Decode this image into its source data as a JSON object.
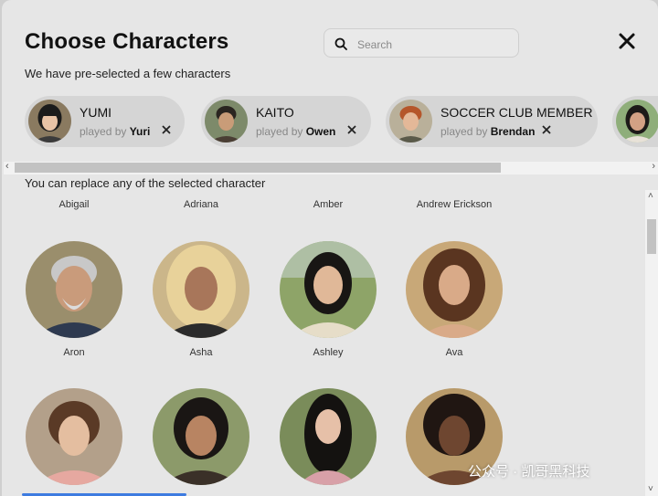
{
  "header": {
    "title": "Choose Characters",
    "subtitle": "We have pre-selected a few characters",
    "search_placeholder": "Search"
  },
  "selected": [
    {
      "name": "YUMI",
      "played_by_label": "played by",
      "actor": "Yuri"
    },
    {
      "name": "KAITO",
      "played_by_label": "played by",
      "actor": "Owen"
    },
    {
      "name": "SOCCER CLUB MEMBER",
      "played_by_label": "played by",
      "actor": "Brendan"
    }
  ],
  "replace_text": "You can replace any of the selected character",
  "list": {
    "name_only": [
      "Abigail",
      "Adriana",
      "Amber",
      "Andrew Erickson"
    ],
    "row1": [
      "Aron",
      "Asha",
      "Ashley",
      "Ava"
    ],
    "row2": [
      "",
      "",
      "",
      ""
    ]
  },
  "watermark": "公众号 · 凯哥黑科技",
  "colors": {
    "modal_bg": "#e6e6e6",
    "chip_bg": "#d5d5d5",
    "accent": "#3d7be0"
  },
  "icons": [
    "search-icon",
    "close-icon",
    "remove-icon",
    "chevron-left-icon",
    "chevron-right-icon",
    "chevron-up-icon",
    "chevron-down-icon"
  ]
}
